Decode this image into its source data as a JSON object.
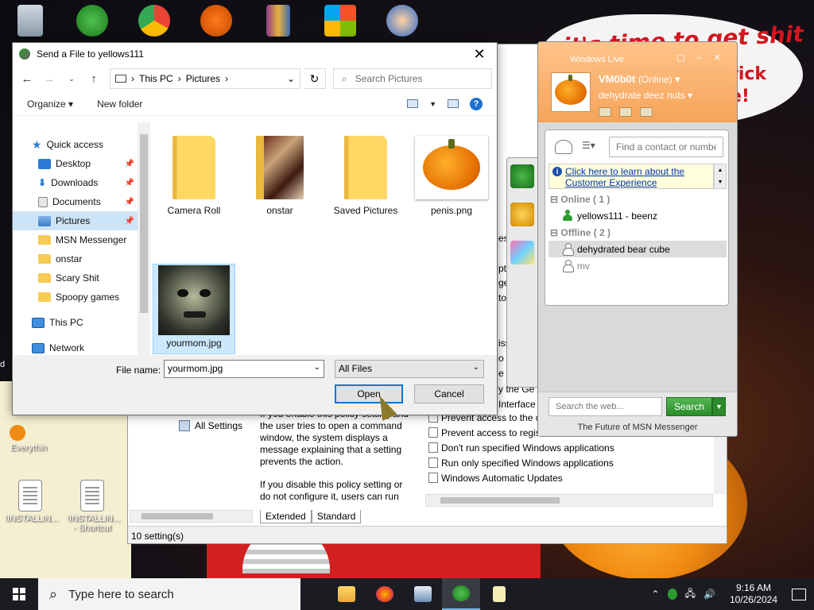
{
  "desktop": {
    "wallpaper_text_1": "it's time to get shit",
    "wallpaper_text_2": "rick\ne!",
    "icons": [
      {
        "label": ""
      },
      {
        "label": ""
      },
      {
        "label": ""
      },
      {
        "label": ""
      },
      {
        "label": ""
      },
      {
        "label": ""
      },
      {
        "label": ""
      },
      {
        "label": "d"
      },
      {
        "label": "Everythin"
      },
      {
        "label": "!INSTALLIN..."
      },
      {
        "label": "!INSTALLIN... - Shortcut"
      }
    ]
  },
  "background_window": {
    "tree_item": "All Settings",
    "description_1": "If you enable this policy setting and the user tries to open a command window, the system displays a message explaining that a setting prevents the action.",
    "description_2": "If you disable this policy setting or do not configure it, users can run Cmd.exe and batch files normally.",
    "peek_texts": [
      "es",
      "pt",
      "ge",
      "to",
      "iss",
      "o",
      "e p",
      "y the Ge",
      "Interface"
    ],
    "policies": [
      "Prevent access to the c",
      "Prevent access to regis",
      "Don't run specified Windows applications",
      "Run only specified Windows applications",
      "Windows Automatic Updates"
    ],
    "tabs": [
      "Extended",
      "Standard"
    ],
    "status": "10 setting(s)"
  },
  "dialog": {
    "title": "Send a File to yellows111",
    "breadcrumb": [
      "This PC",
      "Pictures"
    ],
    "search_placeholder": "Search Pictures",
    "organize": "Organize",
    "new_folder": "New folder",
    "nav": {
      "quick_access": "Quick access",
      "items": [
        "Desktop",
        "Downloads",
        "Documents",
        "Pictures",
        "MSN Messenger",
        "onstar",
        "Scary Shit",
        "Spoopy games"
      ],
      "this_pc": "This PC",
      "network": "Network"
    },
    "files": [
      "Camera Roll",
      "onstar",
      "Saved Pictures",
      "penis.png",
      "yourmom.jpg"
    ],
    "filename_label": "File name:",
    "filename_value": "yourmom.jpg",
    "filter_value": "All Files",
    "open": "Open",
    "cancel": "Cancel"
  },
  "messenger": {
    "title": "Windows Live",
    "name": "VM0b0t",
    "status": "(Online)",
    "personal_message": "dehydrate deez nuts",
    "find_placeholder": "Find a contact or number",
    "info_link": "Click here to learn about the Customer Experience",
    "group_online": "Online ( 1 )",
    "group_offline": "Offline ( 2 )",
    "contacts": [
      "yellows111 - beenz",
      "dehydrated bear cube",
      "mv"
    ],
    "web_search_placeholder": "Search the web...",
    "search_button": "Search",
    "tagline": "The Future of MSN Messenger"
  },
  "taskbar": {
    "search_placeholder": "Type here to search",
    "time": "9:16 AM",
    "date": "10/26/2024"
  }
}
